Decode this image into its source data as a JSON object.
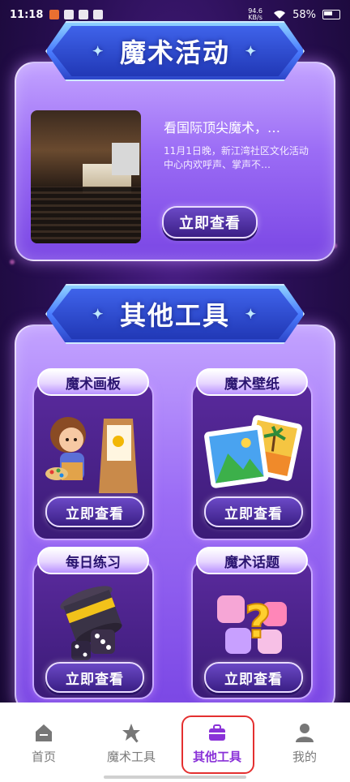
{
  "status_bar": {
    "time": "11:18",
    "network_speed": "94.6 KB/s",
    "battery": "58%"
  },
  "activity_section": {
    "banner_title": "魔术活动",
    "card": {
      "title": "看国际顶尖魔术，…",
      "description": "11月1日晚，新江湾社区文化活动中心内欢呼声、掌声不…",
      "button_label": "立即查看"
    }
  },
  "tools_section": {
    "banner_title": "其他工具",
    "tools": [
      {
        "label": "魔术画板",
        "button_label": "立即查看",
        "icon": "painting-girl-icon"
      },
      {
        "label": "魔术壁纸",
        "button_label": "立即查看",
        "icon": "wallpaper-photos-icon"
      },
      {
        "label": "每日练习",
        "button_label": "立即查看",
        "icon": "magic-hat-dice-icon"
      },
      {
        "label": "魔术话题",
        "button_label": "立即查看",
        "icon": "puzzle-question-icon"
      }
    ]
  },
  "tab_bar": {
    "tabs": [
      {
        "label": "首页",
        "icon": "home-icon"
      },
      {
        "label": "魔术工具",
        "icon": "magic-wand-icon"
      },
      {
        "label": "其他工具",
        "icon": "briefcase-icon",
        "active": true
      },
      {
        "label": "我的",
        "icon": "profile-icon"
      }
    ],
    "active_color": "#8a32d8"
  }
}
